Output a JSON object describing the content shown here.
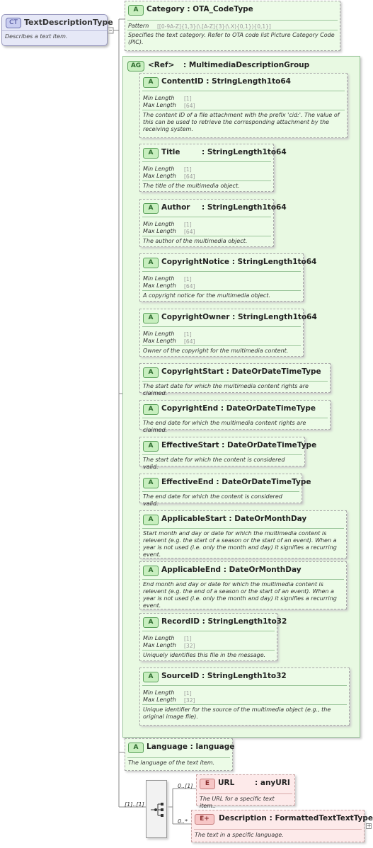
{
  "complex_type": {
    "badge": "CT",
    "name": "TextDescriptionType",
    "description": "Describes a text item."
  },
  "category": {
    "badge": "A",
    "name": "Category",
    "type": "OTA_CodeType",
    "pattern_label": "Pattern",
    "pattern_value": "[[0-9A-Z]{1,3}(\\.[A-Z]{3}(\\.X){0,1}){0,1}]",
    "description": "Specifies the text category. Refer to OTA code list Picture Category Code (PIC)."
  },
  "group": {
    "badge": "AG",
    "ref": "<Ref>",
    "type": "MultimediaDescriptionGroup"
  },
  "attributes": [
    {
      "name": "ContentID",
      "type": "StringLength1to64",
      "facets": [
        {
          "label": "Min Length",
          "value": "[1]"
        },
        {
          "label": "Max Length",
          "value": "[64]"
        }
      ],
      "description": "The content ID of a file attachment with the prefix 'cid:'. The value of this can be used to retrieve the corresponding attachment by the receiving system."
    },
    {
      "name": "Title",
      "type": "StringLength1to64",
      "facets": [
        {
          "label": "Min Length",
          "value": "[1]"
        },
        {
          "label": "Max Length",
          "value": "[64]"
        }
      ],
      "description": "The title of the multimedia object."
    },
    {
      "name": "Author",
      "type": "StringLength1to64",
      "facets": [
        {
          "label": "Min Length",
          "value": "[1]"
        },
        {
          "label": "Max Length",
          "value": "[64]"
        }
      ],
      "description": "The author of the multimedia object."
    },
    {
      "name": "CopyrightNotice",
      "type": "StringLength1to64",
      "facets": [
        {
          "label": "Min Length",
          "value": "[1]"
        },
        {
          "label": "Max Length",
          "value": "[64]"
        }
      ],
      "description": "A copyright notice for the multimedia object."
    },
    {
      "name": "CopyrightOwner",
      "type": "StringLength1to64",
      "facets": [
        {
          "label": "Min Length",
          "value": "[1]"
        },
        {
          "label": "Max Length",
          "value": "[64]"
        }
      ],
      "description": "Owner of the copyright for the multimedia content."
    },
    {
      "name": "CopyrightStart",
      "type": "DateOrDateTimeType",
      "facets": [],
      "description": "The start date for which the multimedia content rights are claimed."
    },
    {
      "name": "CopyrightEnd",
      "type": "DateOrDateTimeType",
      "facets": [],
      "description": "The end date for which the multimedia content rights are claimed."
    },
    {
      "name": "EffectiveStart",
      "type": "DateOrDateTimeType",
      "facets": [],
      "description": "The start date for which the content is considered valid."
    },
    {
      "name": "EffectiveEnd",
      "type": "DateOrDateTimeType",
      "facets": [],
      "description": "The end date for which the content is considered valid."
    },
    {
      "name": "ApplicableStart",
      "type": "DateOrMonthDay",
      "facets": [],
      "description": "Start month and day or date for which the multimedia content is relevent (e.g. the start of a season or the start of an event). When a year is not used (i.e. only the month and day) it signifies a recurring event."
    },
    {
      "name": "ApplicableEnd",
      "type": "DateOrMonthDay",
      "facets": [],
      "description": "End month and day or date for which the multimedia content is relevent (e.g. the end of a season or the start of an event). When a year is not used (i.e. only the month and day) it signifies a recurring event."
    },
    {
      "name": "RecordID",
      "type": "StringLength1to32",
      "facets": [
        {
          "label": "Min Length",
          "value": "[1]"
        },
        {
          "label": "Max Length",
          "value": "[32]"
        }
      ],
      "description": "Uniquely identifies this file in the message."
    },
    {
      "name": "SourceID",
      "type": "StringLength1to32",
      "facets": [
        {
          "label": "Min Length",
          "value": "[1]"
        },
        {
          "label": "Max Length",
          "value": "[32]"
        }
      ],
      "description": "Unique identifier for the source of the multimedia object (e.g., the original image file)."
    }
  ],
  "language": {
    "badge": "A",
    "name": "Language",
    "type": "language",
    "description": "The language of the text item."
  },
  "choice": {
    "cardinality": "[1]..[1]"
  },
  "url_element": {
    "badge": "E",
    "name": "URL",
    "type": "anyURI",
    "cardinality": "0..[1]",
    "description": "The URL for a specific text item.."
  },
  "description_element": {
    "badge": "E+",
    "name": "Description",
    "type": "FormattedTextTextType",
    "cardinality": "0..*",
    "description": "The text in a specific language."
  }
}
